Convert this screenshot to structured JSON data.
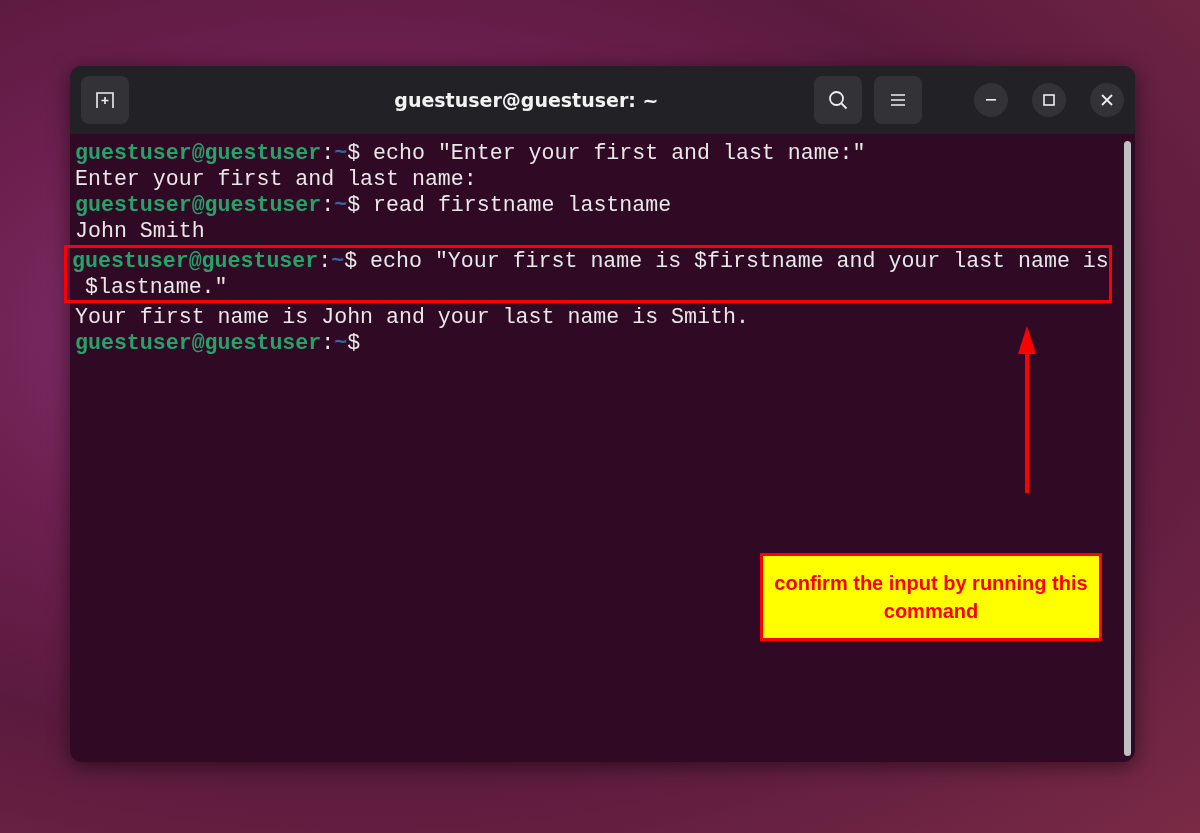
{
  "window": {
    "title": "guestuser@guestuser: ~"
  },
  "terminal": {
    "blocks": [
      {
        "highlighted": false,
        "lines": [
          {
            "kind": "prompt",
            "user": "guestuser@guestuser",
            "separator": ":",
            "path": "~",
            "symbol": "$",
            "command": " echo \"Enter your first and last name:\""
          },
          {
            "kind": "output",
            "text": "Enter your first and last name:"
          },
          {
            "kind": "prompt",
            "user": "guestuser@guestuser",
            "separator": ":",
            "path": "~",
            "symbol": "$",
            "command": " read firstname lastname"
          },
          {
            "kind": "output",
            "text": "John Smith"
          }
        ]
      },
      {
        "highlighted": true,
        "lines": [
          {
            "kind": "prompt",
            "user": "guestuser@guestuser",
            "separator": ":",
            "path": "~",
            "symbol": "$",
            "command": " echo \"Your first name is $firstname and your last name is"
          },
          {
            "kind": "output",
            "text": " $lastname.\""
          }
        ]
      },
      {
        "highlighted": false,
        "lines": [
          {
            "kind": "output",
            "text": "Your first name is John and your last name is Smith."
          },
          {
            "kind": "prompt",
            "user": "guestuser@guestuser",
            "separator": ":",
            "path": "~",
            "symbol": "$"
          }
        ]
      }
    ]
  },
  "callout": {
    "text": "confirm the input by running this  command"
  }
}
